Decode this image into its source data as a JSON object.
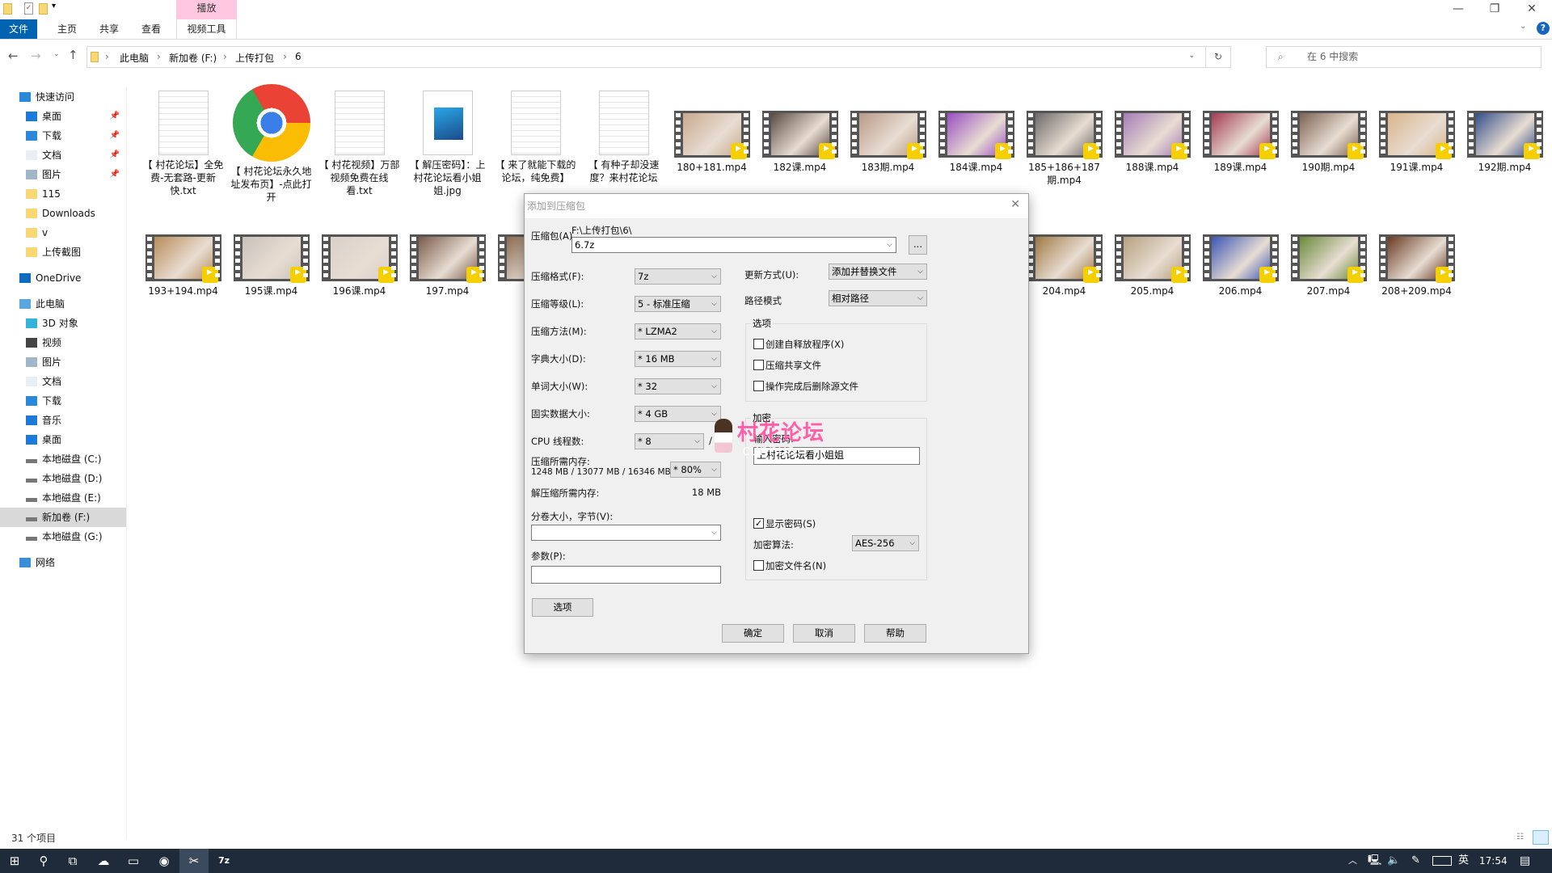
{
  "window": {
    "title": "6",
    "context_tab": "播放",
    "minimize_icon": "minimize-icon",
    "restore_icon": "restore-icon",
    "close_icon": "close-icon",
    "help_icon": "help-icon"
  },
  "ribbon": {
    "tabs": [
      {
        "label": "文件",
        "active": true
      },
      {
        "label": "主页"
      },
      {
        "label": "共享"
      },
      {
        "label": "查看"
      },
      {
        "label": "视频工具"
      }
    ],
    "file_tab_color": "#0063b1"
  },
  "address": {
    "crumbs": [
      "此电脑",
      "新加卷 (F:)",
      "上传打包",
      "6"
    ],
    "search_placeholder": "在 6 中搜索"
  },
  "sidebar": {
    "items": [
      {
        "label": "快速访问",
        "icon": "star-icon",
        "level": 0
      },
      {
        "label": "桌面",
        "icon": "desktop-icon",
        "level": 1,
        "pinned": true
      },
      {
        "label": "下载",
        "icon": "download-icon",
        "level": 1,
        "pinned": true
      },
      {
        "label": "文档",
        "icon": "document-icon",
        "level": 1,
        "pinned": true
      },
      {
        "label": "图片",
        "icon": "pictures-icon",
        "level": 1,
        "pinned": true
      },
      {
        "label": "115",
        "icon": "folder-icon",
        "level": 1
      },
      {
        "label": "Downloads",
        "icon": "folder-icon",
        "level": 1
      },
      {
        "label": "v",
        "icon": "folder-icon",
        "level": 1
      },
      {
        "label": "上传截图",
        "icon": "folder-icon",
        "level": 1
      },
      {
        "label": "OneDrive",
        "icon": "cloud-icon",
        "level": 0,
        "gap": true
      },
      {
        "label": "此电脑",
        "icon": "computer-icon",
        "level": 0,
        "gap": true
      },
      {
        "label": "3D 对象",
        "icon": "cube-icon",
        "level": 1
      },
      {
        "label": "视频",
        "icon": "video-icon",
        "level": 1
      },
      {
        "label": "图片",
        "icon": "pictures-icon",
        "level": 1
      },
      {
        "label": "文档",
        "icon": "document-icon",
        "level": 1
      },
      {
        "label": "下载",
        "icon": "download-icon",
        "level": 1
      },
      {
        "label": "音乐",
        "icon": "music-icon",
        "level": 1
      },
      {
        "label": "桌面",
        "icon": "desktop-icon",
        "level": 1
      },
      {
        "label": "本地磁盘 (C:)",
        "icon": "drive-icon",
        "level": 1
      },
      {
        "label": "本地磁盘 (D:)",
        "icon": "drive-icon",
        "level": 1
      },
      {
        "label": "本地磁盘 (E:)",
        "icon": "drive-icon",
        "level": 1
      },
      {
        "label": "新加卷 (F:)",
        "icon": "drive-icon",
        "level": 1,
        "selected": true
      },
      {
        "label": "本地磁盘 (G:)",
        "icon": "drive-icon",
        "level": 1
      },
      {
        "label": "网络",
        "icon": "network-icon",
        "level": 0,
        "gap": true
      }
    ]
  },
  "files": {
    "row1": [
      {
        "name": "【 村花论坛】全免费-无套路-更新快.txt",
        "type": "txt"
      },
      {
        "name": "【 村花论坛永久地址发布页】-点此打开",
        "type": "chrome-shortcut"
      },
      {
        "name": "【 村花视频】万部视频免费在线看.txt",
        "type": "txt"
      },
      {
        "name": "【 解压密码】：上村花论坛看小姐姐.jpg",
        "type": "jpg"
      },
      {
        "name": "【 来了就能下载的论坛，纯免费】",
        "type": "txt"
      },
      {
        "name": "【 有种子却没速度？来村花论坛",
        "type": "txt"
      },
      {
        "name": "180+181.mp4",
        "type": "mp4",
        "color": "#c9a98f"
      },
      {
        "name": "182课.mp4",
        "type": "mp4",
        "color": "#5a4a42"
      },
      {
        "name": "183期.mp4",
        "type": "mp4",
        "color": "#b89a88"
      },
      {
        "name": "184课.mp4",
        "type": "mp4",
        "color": "#9a4fc2"
      },
      {
        "name": "185+186+187期.mp4",
        "type": "mp4",
        "color": "#6e6a6a"
      },
      {
        "name": "188课.mp4",
        "type": "mp4",
        "color": "#a57cb8"
      },
      {
        "name": "189课.mp4",
        "type": "mp4",
        "color": "#a33b55"
      },
      {
        "name": "190期.mp4",
        "type": "mp4",
        "color": "#7d6353"
      },
      {
        "name": "191课.mp4",
        "type": "mp4",
        "color": "#d9b48a"
      },
      {
        "name": "192期.mp4",
        "type": "mp4",
        "color": "#34508a"
      }
    ],
    "row2": [
      {
        "name": "193+194.mp4",
        "col": 0,
        "color": "#b98c5a"
      },
      {
        "name": "195课.mp4",
        "col": 1,
        "color": "#c8c2bc"
      },
      {
        "name": "196课.mp4",
        "col": 2,
        "color": "#d8d0cc"
      },
      {
        "name": "197.mp4",
        "col": 3,
        "color": "#7a5a4a"
      },
      {
        "name": "19",
        "col": 4,
        "color": "#8a6a50"
      },
      {
        "name": "204.mp4",
        "col": 10,
        "color": "#a07a45"
      },
      {
        "name": "205.mp4",
        "col": 11,
        "color": "#b6a080"
      },
      {
        "name": "206.mp4",
        "col": 12,
        "color": "#3a55b5"
      },
      {
        "name": "207.mp4",
        "col": 13,
        "color": "#6a8a3a"
      },
      {
        "name": "208+209.mp4",
        "col": 14,
        "color": "#6a3a22"
      }
    ]
  },
  "dialog": {
    "title": "添加到压缩包",
    "archive_label": "压缩包(A)",
    "archive_path": "F:\\上传打包\\6\\",
    "archive_name": "6.7z",
    "browse_label": "...",
    "left": [
      {
        "label": "压缩格式(F):",
        "value": "7z"
      },
      {
        "label": "压缩等级(L):",
        "value": "5 - 标准压缩"
      },
      {
        "label": "压缩方法(M):",
        "value": "* LZMA2"
      },
      {
        "label": "字典大小(D):",
        "value": "* 16 MB"
      },
      {
        "label": "单词大小(W):",
        "value": "* 32"
      },
      {
        "label": "固实数据大小:",
        "value": "* 4 GB"
      },
      {
        "label": "CPU 线程数:",
        "value": "* 8",
        "extra": "/ 8"
      }
    ],
    "mem_label": "压缩所需内存:",
    "mem_value": "1248 MB / 13077 MB / 16346 MB",
    "mem_percent": "* 80%",
    "decomp_label": "解压缩所需内存:",
    "decomp_value": "18 MB",
    "split_label": "分卷大小，字节(V):",
    "split_value": "",
    "params_label": "参数(P):",
    "params_value": "",
    "options_button": "选项",
    "update_label": "更新方式(U):",
    "update_value": "添加并替换文件",
    "path_label": "路径模式",
    "path_value": "相对路径",
    "options_group": "选项",
    "options": [
      {
        "label": "创建自释放程序(X)",
        "checked": false
      },
      {
        "label": "压缩共享文件",
        "checked": false
      },
      {
        "label": "操作完成后删除源文件",
        "checked": false
      }
    ],
    "enc_group": "加密",
    "pwd_label": "输入密码:",
    "pwd_value": "上村花论坛看小姐姐",
    "show_pwd": {
      "label": "显示密码(S)",
      "checked": true
    },
    "enc_method_label": "加密算法:",
    "enc_method_value": "AES-256",
    "enc_names": {
      "label": "加密文件名(N)",
      "checked": false
    },
    "ok": "确定",
    "cancel": "取消",
    "help": "帮助"
  },
  "watermark": {
    "text": "村花论坛",
    "sub": "cunhua."
  },
  "status": {
    "count": "31 个项目"
  },
  "taskbar": {
    "apps": [
      "windows-start-icon",
      "search-icon",
      "task-view-icon",
      "baidu-netdisk-icon",
      "file-explorer-icon",
      "chrome-icon",
      "app-icon",
      "7zip-icon"
    ],
    "ime": "英",
    "time": "17:54"
  }
}
